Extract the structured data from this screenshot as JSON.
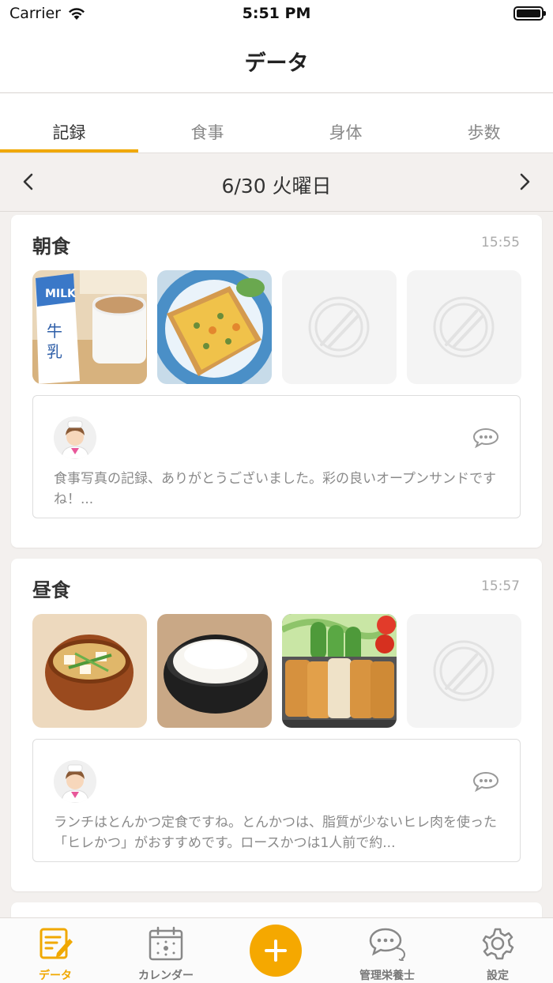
{
  "status": {
    "carrier": "Carrier",
    "time": "5:51 PM"
  },
  "nav": {
    "title": "データ"
  },
  "tabs": [
    {
      "label": "記録",
      "active": true
    },
    {
      "label": "食事",
      "active": false
    },
    {
      "label": "身体",
      "active": false
    },
    {
      "label": "歩数",
      "active": false
    }
  ],
  "date": {
    "label": "6/30 火曜日",
    "prev_icon": "chevron-left-icon",
    "next_icon": "chevron-right-icon"
  },
  "meals": [
    {
      "name": "朝食",
      "time": "15:55",
      "photos": [
        "milk-and-coffee-photo",
        "open-sandwich-toast-photo",
        "empty",
        "empty"
      ],
      "comment": "食事写真の記録、ありがとうございました。彩の良いオープンサンドですね！..."
    },
    {
      "name": "昼食",
      "time": "15:57",
      "photos": [
        "miso-soup-photo",
        "rice-bowl-photo",
        "tonkatsu-photo",
        "empty"
      ],
      "comment": "ランチはとんかつ定食ですね。とんかつは、脂質が少ないヒレ肉を使った「ヒレかつ」がおすすめです。ロースかつは1人前で約..."
    }
  ],
  "tabbar": {
    "items": [
      {
        "label": "データ",
        "icon": "edit-document-icon",
        "active": true
      },
      {
        "label": "カレンダー",
        "icon": "calendar-icon",
        "active": false
      },
      {
        "label": "",
        "icon": "plus-icon",
        "active": false
      },
      {
        "label": "管理栄養士",
        "icon": "chat-bubbles-icon",
        "active": false
      },
      {
        "label": "設定",
        "icon": "gear-icon",
        "active": false
      }
    ]
  },
  "colors": {
    "accent": "#f0a800",
    "background": "#f3f0ee"
  }
}
